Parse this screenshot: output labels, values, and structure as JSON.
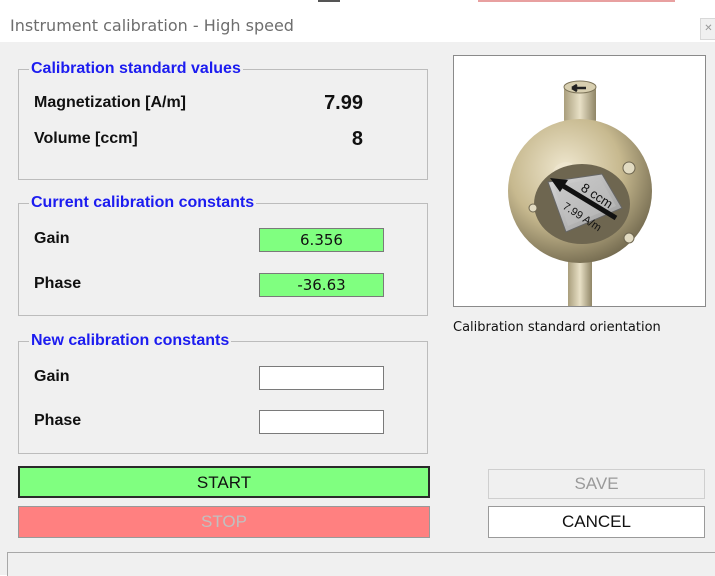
{
  "window": {
    "title": "Instrument calibration - High speed"
  },
  "standard": {
    "legend": "Calibration standard values",
    "magnetization_label": "Magnetization [A/m]",
    "magnetization_value": "7.99",
    "volume_label": "Volume [ccm]",
    "volume_value": "8"
  },
  "current": {
    "legend": "Current calibration constants",
    "gain_label": "Gain",
    "gain_value": "6.356",
    "phase_label": "Phase",
    "phase_value": "-36.63"
  },
  "new": {
    "legend": "New calibration constants",
    "gain_label": "Gain",
    "gain_value": "",
    "phase_label": "Phase",
    "phase_value": ""
  },
  "image": {
    "caption": "Calibration standard orientation",
    "text_volume": "8 ccm",
    "text_magnetization": "7.99 A/m"
  },
  "buttons": {
    "start": "START",
    "stop": "STOP",
    "save": "SAVE",
    "cancel": "CANCEL"
  },
  "colors": {
    "legend_blue": "#1c1cf0",
    "current_value_bg": "#80ff80",
    "start_bg": "#80ff80",
    "stop_bg": "#ff8080"
  }
}
